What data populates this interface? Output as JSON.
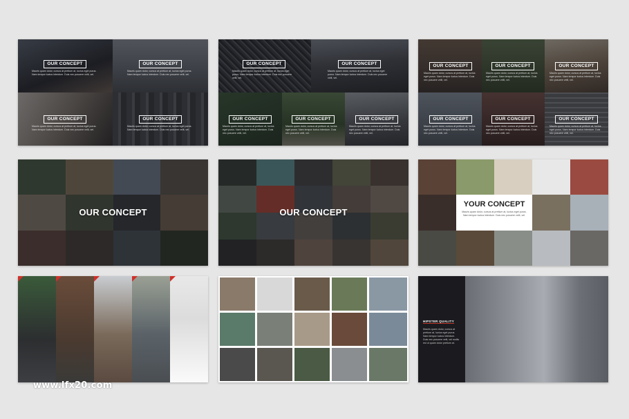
{
  "slides": {
    "s1": {
      "concepts": [
        {
          "label": "OUR CONCEPT",
          "desc": "Mauris quam dolor, cursus at pretium at, luctus eget purus. Nam tempor luctus interdum. Duis nec posuere velit, vel."
        },
        {
          "label": "OUR CONCEPT",
          "desc": "Mauris quam dolor, cursus at pretium at, luctus eget purus. Nam tempor luctus interdum. Duis nec posuere velit, vel."
        },
        {
          "label": "OUR CONCEPT",
          "desc": "Mauris quam dolor, cursus at pretium at, luctus eget purus. Nam tempor luctus interdum. Duis nec posuere velit, vel."
        },
        {
          "label": "OUR CONCEPT",
          "desc": "Mauris quam dolor, cursus at pretium at, luctus eget purus. Nam tempor luctus interdum. Duis nec posuere velit, vel."
        }
      ]
    },
    "s2": {
      "concepts": [
        {
          "label": "OUR CONCEPT",
          "desc": "Mauris quam dolor, cursus at pretium at, luctus eget purus. Nam tempor luctus interdum. Duis nec posuere velit, vel."
        },
        {
          "label": "OUR CONCEPT",
          "desc": "Mauris quam dolor, cursus at pretium at, luctus eget purus. Nam tempor luctus interdum. Duis nec posuere velit, vel."
        },
        {
          "label": "OUR CONCEPT",
          "desc": "Mauris quam dolor, cursus at pretium at, luctus eget purus. Nam tempor luctus interdum. Duis nec posuere velit, vel."
        },
        {
          "label": "OUR CONCEPT",
          "desc": "Mauris quam dolor, cursus at pretium at, luctus eget purus. Nam tempor luctus interdum. Duis nec posuere velit, vel."
        },
        {
          "label": "OUR CONCEPT",
          "desc": "Mauris quam dolor, cursus at pretium at, luctus eget purus. Nam tempor luctus interdum. Duis nec posuere velit, vel."
        }
      ]
    },
    "s3": {
      "concepts": [
        {
          "label": "OUR CONCEPT",
          "desc": "Mauris quam dolor, cursus at pretium at, luctus eget purus. Nam tempor luctus interdum. Duis nec posuere velit, vel."
        },
        {
          "label": "OUR CONCEPT",
          "desc": "Mauris quam dolor, cursus at pretium at, luctus eget purus. Nam tempor luctus interdum. Duis nec posuere velit, vel."
        },
        {
          "label": "OUR CONCEPT",
          "desc": "Mauris quam dolor, cursus at pretium at, luctus eget purus. Nam tempor luctus interdum. Duis nec posuere velit, vel."
        },
        {
          "label": "OUR CONCEPT",
          "desc": "Mauris quam dolor, cursus at pretium at, luctus eget purus. Nam tempor luctus interdum. Duis nec posuere velit, vel."
        },
        {
          "label": "OUR CONCEPT",
          "desc": "Mauris quam dolor, cursus at pretium at, luctus eget purus. Nam tempor luctus interdum. Duis nec posuere velit, vel."
        },
        {
          "label": "OUR CONCEPT",
          "desc": "Mauris quam dolor, cursus at pretium at, luctus eget purus. Nam tempor luctus interdum. Duis nec posuere velit, vel."
        }
      ]
    },
    "s4": {
      "title": "OUR CONCEPT"
    },
    "s5": {
      "title": "OUR CONCEPT"
    },
    "s6": {
      "title": "YOUR CONCEPT",
      "desc": "Mauris quam dolor, cursus at pretium at, luctus eget purus. Nam tempor luctus interdum. Duis nec posuere velit, vel."
    },
    "s9": {
      "title": "HIPSTER QUALITY",
      "desc": "Mauris quam dolor, cursus at pretium at, luctus eget purus. Nam tempor luctus interdum. Duis nec posuere velit, vel mollis est ut quam dolor pretium at."
    }
  },
  "watermark": "www.lfx20.com",
  "colors": {
    "page_bg": "#e6e6e6",
    "dark_overlay": "#1b1b1f",
    "accent_red": "#d0302a"
  }
}
